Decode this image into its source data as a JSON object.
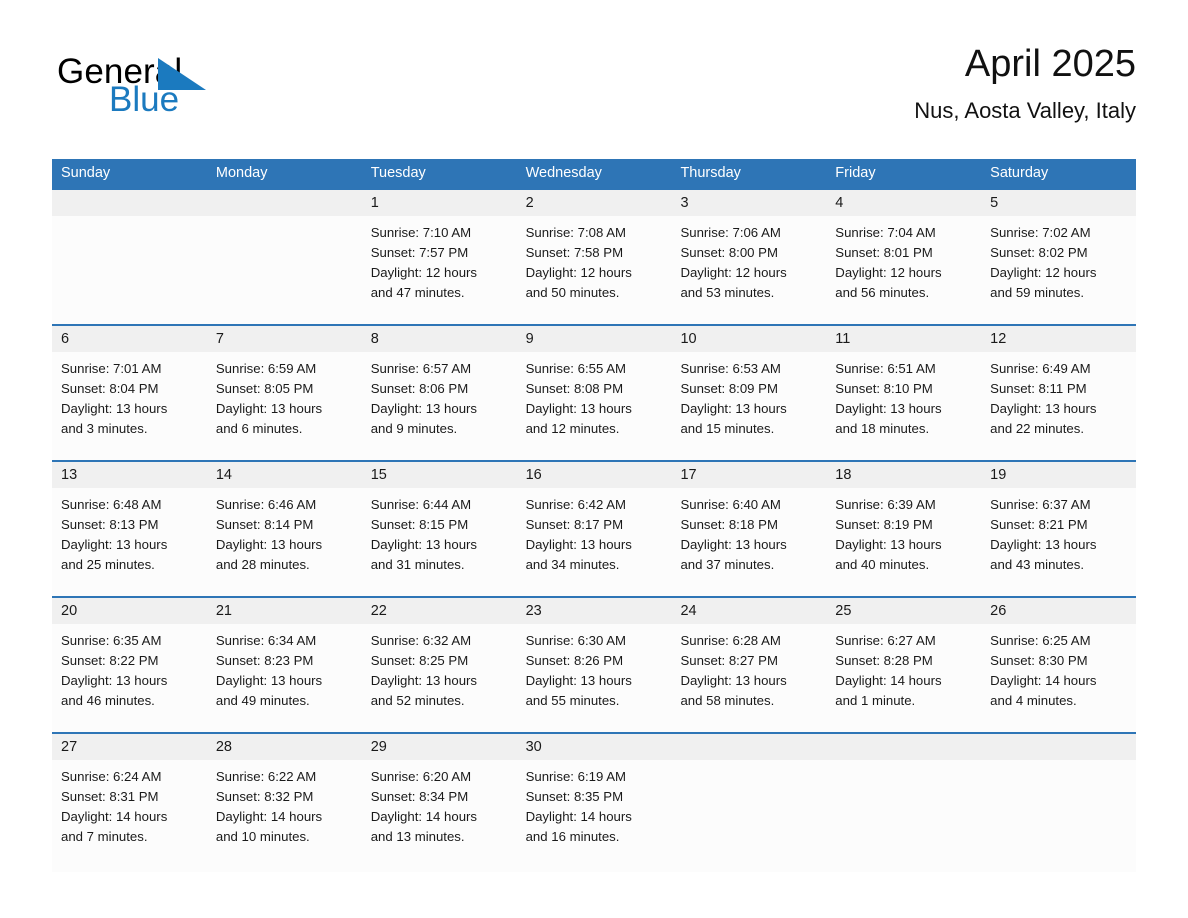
{
  "logo": {
    "word_one": "General",
    "word_two": "Blue",
    "triangle_color": "#1b7abf",
    "text_color": "#000000"
  },
  "header": {
    "title": "April 2025",
    "location": "Nus, Aosta Valley, Italy"
  },
  "theme": {
    "header_blue": "#2e75b6",
    "row_separator_blue": "#2e75b6",
    "day_number_band": "#f0f0f0",
    "cell_background": "#fcfcfc"
  },
  "weekday_headers": [
    "Sunday",
    "Monday",
    "Tuesday",
    "Wednesday",
    "Thursday",
    "Friday",
    "Saturday"
  ],
  "weeks": [
    {
      "days": [
        {
          "number": "",
          "sunrise": "",
          "sunset": "",
          "daylight_1": "",
          "daylight_2": ""
        },
        {
          "number": "",
          "sunrise": "",
          "sunset": "",
          "daylight_1": "",
          "daylight_2": ""
        },
        {
          "number": "1",
          "sunrise": "Sunrise: 7:10 AM",
          "sunset": "Sunset: 7:57 PM",
          "daylight_1": "Daylight: 12 hours",
          "daylight_2": "and 47 minutes."
        },
        {
          "number": "2",
          "sunrise": "Sunrise: 7:08 AM",
          "sunset": "Sunset: 7:58 PM",
          "daylight_1": "Daylight: 12 hours",
          "daylight_2": "and 50 minutes."
        },
        {
          "number": "3",
          "sunrise": "Sunrise: 7:06 AM",
          "sunset": "Sunset: 8:00 PM",
          "daylight_1": "Daylight: 12 hours",
          "daylight_2": "and 53 minutes."
        },
        {
          "number": "4",
          "sunrise": "Sunrise: 7:04 AM",
          "sunset": "Sunset: 8:01 PM",
          "daylight_1": "Daylight: 12 hours",
          "daylight_2": "and 56 minutes."
        },
        {
          "number": "5",
          "sunrise": "Sunrise: 7:02 AM",
          "sunset": "Sunset: 8:02 PM",
          "daylight_1": "Daylight: 12 hours",
          "daylight_2": "and 59 minutes."
        }
      ]
    },
    {
      "days": [
        {
          "number": "6",
          "sunrise": "Sunrise: 7:01 AM",
          "sunset": "Sunset: 8:04 PM",
          "daylight_1": "Daylight: 13 hours",
          "daylight_2": "and 3 minutes."
        },
        {
          "number": "7",
          "sunrise": "Sunrise: 6:59 AM",
          "sunset": "Sunset: 8:05 PM",
          "daylight_1": "Daylight: 13 hours",
          "daylight_2": "and 6 minutes."
        },
        {
          "number": "8",
          "sunrise": "Sunrise: 6:57 AM",
          "sunset": "Sunset: 8:06 PM",
          "daylight_1": "Daylight: 13 hours",
          "daylight_2": "and 9 minutes."
        },
        {
          "number": "9",
          "sunrise": "Sunrise: 6:55 AM",
          "sunset": "Sunset: 8:08 PM",
          "daylight_1": "Daylight: 13 hours",
          "daylight_2": "and 12 minutes."
        },
        {
          "number": "10",
          "sunrise": "Sunrise: 6:53 AM",
          "sunset": "Sunset: 8:09 PM",
          "daylight_1": "Daylight: 13 hours",
          "daylight_2": "and 15 minutes."
        },
        {
          "number": "11",
          "sunrise": "Sunrise: 6:51 AM",
          "sunset": "Sunset: 8:10 PM",
          "daylight_1": "Daylight: 13 hours",
          "daylight_2": "and 18 minutes."
        },
        {
          "number": "12",
          "sunrise": "Sunrise: 6:49 AM",
          "sunset": "Sunset: 8:11 PM",
          "daylight_1": "Daylight: 13 hours",
          "daylight_2": "and 22 minutes."
        }
      ]
    },
    {
      "days": [
        {
          "number": "13",
          "sunrise": "Sunrise: 6:48 AM",
          "sunset": "Sunset: 8:13 PM",
          "daylight_1": "Daylight: 13 hours",
          "daylight_2": "and 25 minutes."
        },
        {
          "number": "14",
          "sunrise": "Sunrise: 6:46 AM",
          "sunset": "Sunset: 8:14 PM",
          "daylight_1": "Daylight: 13 hours",
          "daylight_2": "and 28 minutes."
        },
        {
          "number": "15",
          "sunrise": "Sunrise: 6:44 AM",
          "sunset": "Sunset: 8:15 PM",
          "daylight_1": "Daylight: 13 hours",
          "daylight_2": "and 31 minutes."
        },
        {
          "number": "16",
          "sunrise": "Sunrise: 6:42 AM",
          "sunset": "Sunset: 8:17 PM",
          "daylight_1": "Daylight: 13 hours",
          "daylight_2": "and 34 minutes."
        },
        {
          "number": "17",
          "sunrise": "Sunrise: 6:40 AM",
          "sunset": "Sunset: 8:18 PM",
          "daylight_1": "Daylight: 13 hours",
          "daylight_2": "and 37 minutes."
        },
        {
          "number": "18",
          "sunrise": "Sunrise: 6:39 AM",
          "sunset": "Sunset: 8:19 PM",
          "daylight_1": "Daylight: 13 hours",
          "daylight_2": "and 40 minutes."
        },
        {
          "number": "19",
          "sunrise": "Sunrise: 6:37 AM",
          "sunset": "Sunset: 8:21 PM",
          "daylight_1": "Daylight: 13 hours",
          "daylight_2": "and 43 minutes."
        }
      ]
    },
    {
      "days": [
        {
          "number": "20",
          "sunrise": "Sunrise: 6:35 AM",
          "sunset": "Sunset: 8:22 PM",
          "daylight_1": "Daylight: 13 hours",
          "daylight_2": "and 46 minutes."
        },
        {
          "number": "21",
          "sunrise": "Sunrise: 6:34 AM",
          "sunset": "Sunset: 8:23 PM",
          "daylight_1": "Daylight: 13 hours",
          "daylight_2": "and 49 minutes."
        },
        {
          "number": "22",
          "sunrise": "Sunrise: 6:32 AM",
          "sunset": "Sunset: 8:25 PM",
          "daylight_1": "Daylight: 13 hours",
          "daylight_2": "and 52 minutes."
        },
        {
          "number": "23",
          "sunrise": "Sunrise: 6:30 AM",
          "sunset": "Sunset: 8:26 PM",
          "daylight_1": "Daylight: 13 hours",
          "daylight_2": "and 55 minutes."
        },
        {
          "number": "24",
          "sunrise": "Sunrise: 6:28 AM",
          "sunset": "Sunset: 8:27 PM",
          "daylight_1": "Daylight: 13 hours",
          "daylight_2": "and 58 minutes."
        },
        {
          "number": "25",
          "sunrise": "Sunrise: 6:27 AM",
          "sunset": "Sunset: 8:28 PM",
          "daylight_1": "Daylight: 14 hours",
          "daylight_2": "and 1 minute."
        },
        {
          "number": "26",
          "sunrise": "Sunrise: 6:25 AM",
          "sunset": "Sunset: 8:30 PM",
          "daylight_1": "Daylight: 14 hours",
          "daylight_2": "and 4 minutes."
        }
      ]
    },
    {
      "days": [
        {
          "number": "27",
          "sunrise": "Sunrise: 6:24 AM",
          "sunset": "Sunset: 8:31 PM",
          "daylight_1": "Daylight: 14 hours",
          "daylight_2": "and 7 minutes."
        },
        {
          "number": "28",
          "sunrise": "Sunrise: 6:22 AM",
          "sunset": "Sunset: 8:32 PM",
          "daylight_1": "Daylight: 14 hours",
          "daylight_2": "and 10 minutes."
        },
        {
          "number": "29",
          "sunrise": "Sunrise: 6:20 AM",
          "sunset": "Sunset: 8:34 PM",
          "daylight_1": "Daylight: 14 hours",
          "daylight_2": "and 13 minutes."
        },
        {
          "number": "30",
          "sunrise": "Sunrise: 6:19 AM",
          "sunset": "Sunset: 8:35 PM",
          "daylight_1": "Daylight: 14 hours",
          "daylight_2": "and 16 minutes."
        },
        {
          "number": "",
          "sunrise": "",
          "sunset": "",
          "daylight_1": "",
          "daylight_2": ""
        },
        {
          "number": "",
          "sunrise": "",
          "sunset": "",
          "daylight_1": "",
          "daylight_2": ""
        },
        {
          "number": "",
          "sunrise": "",
          "sunset": "",
          "daylight_1": "",
          "daylight_2": ""
        }
      ]
    }
  ]
}
